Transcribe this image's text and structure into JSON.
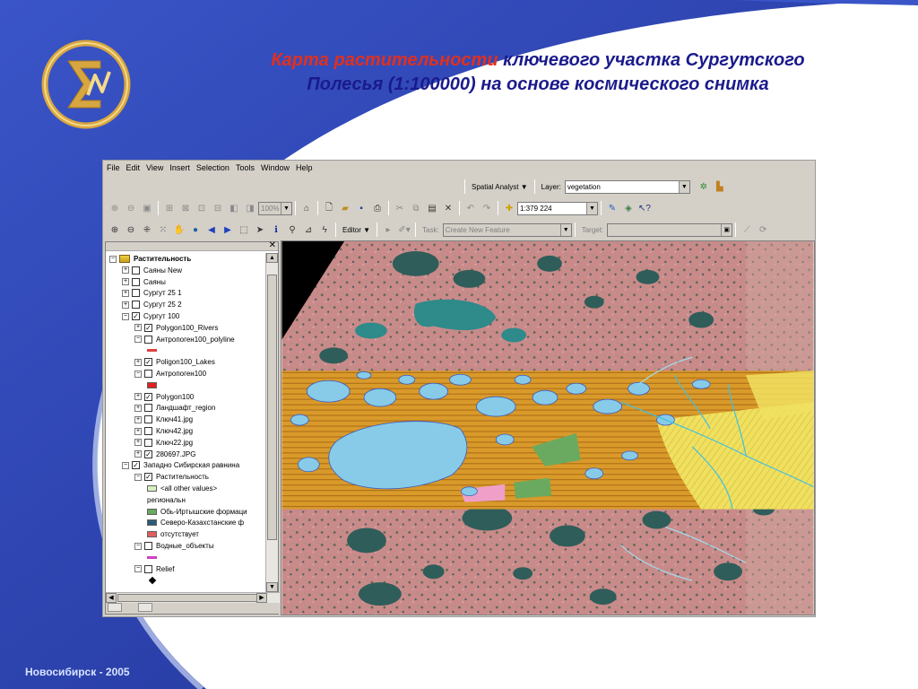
{
  "slide": {
    "title_line1_red": "Карта растительности",
    "title_line1_blue": " ключевого участка Сургутского",
    "title_line2": "Полесья (1:100000) на основе космического снимка",
    "footer": "Новосибирск - 2005",
    "colors": {
      "title_red": "#e0301e",
      "title_blue": "#1a1a8c",
      "background_blue": "#3a55c8",
      "logo_gold": "#d7a640"
    }
  },
  "app": {
    "menu": [
      "File",
      "Edit",
      "View",
      "Insert",
      "Selection",
      "Tools",
      "Window",
      "Help"
    ],
    "spatial_analyst": {
      "label": "Spatial Analyst ▼",
      "layer_label": "Layer:",
      "layer_value": "vegetation"
    },
    "zoom_value": "100%",
    "scale_value": "1:379 224",
    "editor": {
      "label": "Editor ▼",
      "task_label": "Task:",
      "task_value": "Create New Feature",
      "target_label": "Target:",
      "target_value": ""
    },
    "toc": {
      "close_icon": "close-icon",
      "items": [
        {
          "level": 0,
          "expander": "minus",
          "checkbox": null,
          "label": "Растительность",
          "bold": true,
          "icon": "layers-icon"
        },
        {
          "level": 1,
          "expander": "plus",
          "checkbox": false,
          "label": "Саяны New"
        },
        {
          "level": 1,
          "expander": "plus",
          "checkbox": false,
          "label": "Саяны"
        },
        {
          "level": 1,
          "expander": "plus",
          "checkbox": false,
          "label": "Сургут 25 1"
        },
        {
          "level": 1,
          "expander": "plus",
          "checkbox": false,
          "label": "Сургут 25 2"
        },
        {
          "level": 1,
          "expander": "minus",
          "checkbox": true,
          "label": "Сургут 100"
        },
        {
          "level": 2,
          "expander": "plus",
          "checkbox": true,
          "label": "Polygon100_Rivers"
        },
        {
          "level": 2,
          "expander": "minus",
          "checkbox": false,
          "label": "Антропоген100_polyline"
        },
        {
          "level": 3,
          "swatch": "line",
          "color": "#e04040",
          "label": ""
        },
        {
          "level": 2,
          "expander": "plus",
          "checkbox": true,
          "label": "Poligon100_Lakes"
        },
        {
          "level": 2,
          "expander": "minus",
          "checkbox": false,
          "label": "Антропоген100"
        },
        {
          "level": 3,
          "swatch": "fill",
          "color": "#e02020",
          "label": ""
        },
        {
          "level": 2,
          "expander": "plus",
          "checkbox": true,
          "label": "Polygon100"
        },
        {
          "level": 2,
          "expander": "plus",
          "checkbox": false,
          "label": "Ландшафт_region"
        },
        {
          "level": 2,
          "expander": "plus",
          "checkbox": false,
          "label": "Ключ41.jpg"
        },
        {
          "level": 2,
          "expander": "plus",
          "checkbox": false,
          "label": "Ключ42.jpg"
        },
        {
          "level": 2,
          "expander": "plus",
          "checkbox": false,
          "label": "Ключ22.jpg"
        },
        {
          "level": 2,
          "expander": "plus",
          "checkbox": true,
          "label": "280697.JPG"
        },
        {
          "level": 1,
          "expander": "minus",
          "checkbox": true,
          "label": "Западно Сибирская равнина"
        },
        {
          "level": 2,
          "expander": "minus",
          "checkbox": true,
          "label": "Растительность"
        },
        {
          "level": 3,
          "swatch": "fill",
          "color": "#d8f0c0",
          "label": "<all other values>"
        },
        {
          "level": 3,
          "swatch": "none",
          "color": "",
          "label": "региональн"
        },
        {
          "level": 3,
          "swatch": "fill",
          "color": "#6aaa60",
          "label": "Обь-Иртышские формаци"
        },
        {
          "level": 3,
          "swatch": "fill",
          "color": "#2e5a78",
          "label": "Северо-Казахстанские ф"
        },
        {
          "level": 3,
          "swatch": "fill",
          "color": "#e06060",
          "label": "отсутствует"
        },
        {
          "level": 2,
          "expander": "minus",
          "checkbox": false,
          "label": "Водные_объекты"
        },
        {
          "level": 3,
          "swatch": "line",
          "color": "#d040c0",
          "label": ""
        },
        {
          "level": 2,
          "expander": "minus",
          "checkbox": false,
          "label": "Relief"
        },
        {
          "level": 3,
          "swatch": "dot",
          "color": "#000000",
          "label": ""
        }
      ]
    },
    "map_colors": {
      "satellite_pink": "#c98a8a",
      "lake_dark": "#2f5d5a",
      "lake_teal": "#2f8a8a",
      "lake_light_blue": "#87cbe8",
      "vegetation_orange": "#d99a2a",
      "vegetation_yellow": "#f0e060",
      "vegetation_green": "#6aaa60",
      "vegetation_pink": "#f0a0c8"
    }
  }
}
